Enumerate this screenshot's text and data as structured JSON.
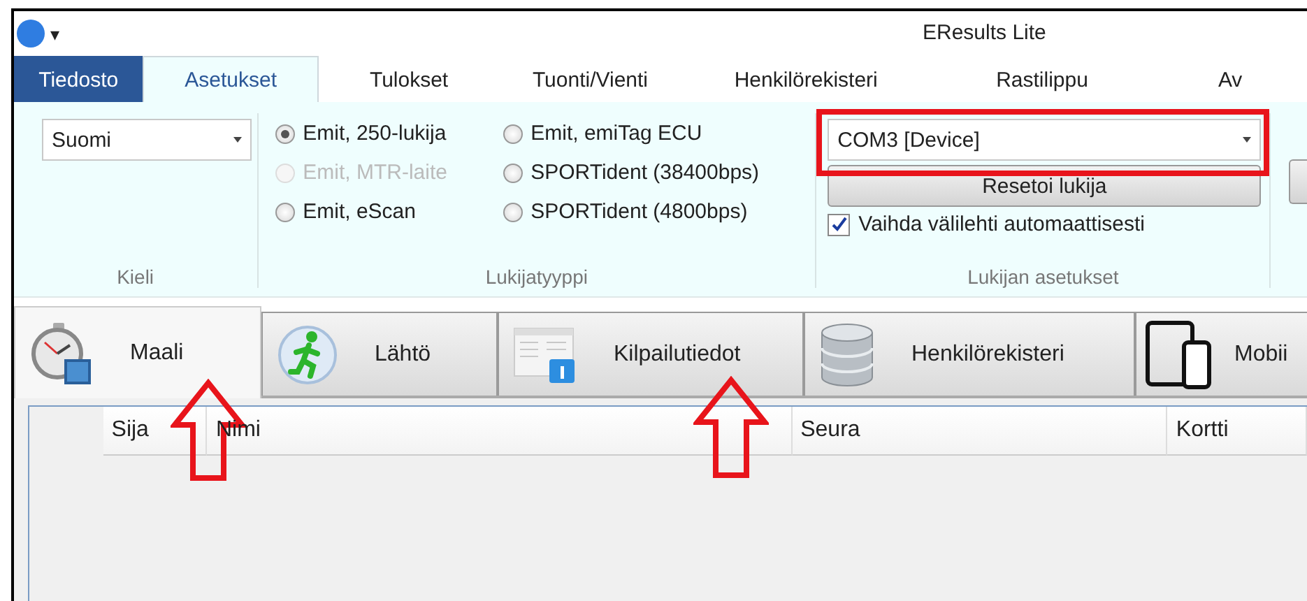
{
  "window": {
    "title": "EResults Lite",
    "quick_access": "▾"
  },
  "ribbon_tabs": [
    {
      "label": "Tiedosto",
      "kind": "file",
      "selected": false
    },
    {
      "label": "Asetukset",
      "kind": "tab",
      "selected": true
    },
    {
      "label": "Tulokset",
      "kind": "tab",
      "selected": false
    },
    {
      "label": "Tuonti/Vienti",
      "kind": "tab",
      "selected": false
    },
    {
      "label": "Henkilörekisteri",
      "kind": "tab",
      "selected": false
    },
    {
      "label": "Rastilippu",
      "kind": "tab",
      "selected": false
    },
    {
      "label": "Av",
      "kind": "tab",
      "selected": false
    }
  ],
  "ribbon": {
    "language": {
      "value": "Suomi",
      "label": "Kieli"
    },
    "reader_type": {
      "label": "Lukijatyyppi",
      "options": [
        {
          "label": "Emit, 250-lukija",
          "selected": true,
          "disabled": false
        },
        {
          "label": "Emit, emiTag ECU",
          "selected": false,
          "disabled": false
        },
        {
          "label": "Emit, MTR-laite",
          "selected": false,
          "disabled": true
        },
        {
          "label": "SPORTident (38400bps)",
          "selected": false,
          "disabled": false
        },
        {
          "label": "Emit, eScan",
          "selected": false,
          "disabled": false
        },
        {
          "label": "SPORTident (4800bps)",
          "selected": false,
          "disabled": false
        }
      ]
    },
    "reader_settings": {
      "label": "Lukijan asetukset",
      "port": {
        "value": "COM3 [Device]",
        "highlighted": true
      },
      "reset_button": "Resetoi lukija",
      "auto_switch": {
        "label": "Vaihda välilehti automaattisesti",
        "checked": true
      }
    }
  },
  "main_tabs": [
    {
      "label": "Maali",
      "selected": true,
      "arrow": true
    },
    {
      "label": "Lähtö",
      "selected": false,
      "arrow": false
    },
    {
      "label": "Kilpailutiedot",
      "selected": false,
      "arrow": true
    },
    {
      "label": "Henkilörekisteri",
      "selected": false,
      "arrow": false
    },
    {
      "label": "Mobii",
      "selected": false,
      "arrow": false
    }
  ],
  "table": {
    "columns": [
      "Sija",
      "Nimi",
      "Seura",
      "Kortti"
    ]
  }
}
